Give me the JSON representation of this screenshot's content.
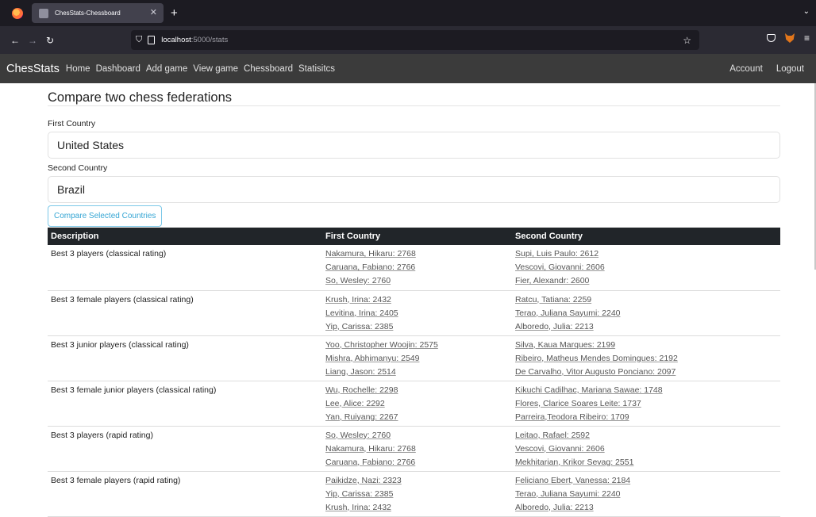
{
  "browser": {
    "tab_title": "ChesStats-Chessboard",
    "url_host": "localhost",
    "url_path": ":5000/stats"
  },
  "nav": {
    "brand": "ChesStats",
    "links": [
      "Home",
      "Dashboard",
      "Add game",
      "View game",
      "Chessboard",
      "Statisitcs"
    ],
    "account": "Account",
    "logout": "Logout"
  },
  "page": {
    "title": "Compare two chess federations",
    "first_label": "First Country",
    "first_value": "United States",
    "second_label": "Second Country",
    "second_value": "Brazil",
    "compare_button": "Compare Selected Countries"
  },
  "table": {
    "headers": [
      "Description",
      "First Country",
      "Second Country"
    ],
    "rows": [
      {
        "desc": "Best 3 players (classical rating)",
        "first": [
          "Nakamura, Hikaru: 2768",
          "Caruana, Fabiano: 2766",
          "So, Wesley: 2760"
        ],
        "second": [
          "Supi, Luis Paulo: 2612",
          "Vescovi, Giovanni: 2606",
          "Fier, Alexandr: 2600"
        ]
      },
      {
        "desc": "Best 3 female players (classical rating)",
        "first": [
          "Krush, Irina: 2432",
          "Levitina, Irina: 2405",
          "Yip, Carissa: 2385"
        ],
        "second": [
          "Ratcu, Tatiana: 2259",
          "Terao, Juliana Sayumi: 2240",
          "Alboredo, Julia: 2213"
        ]
      },
      {
        "desc": "Best 3 junior players (classical rating)",
        "first": [
          "Yoo, Christopher Woojin: 2575",
          "Mishra, Abhimanyu: 2549",
          "Liang, Jason: 2514"
        ],
        "second": [
          "Silva, Kaua Marques: 2199",
          "Ribeiro, Matheus Mendes Domingues: 2192",
          "De Carvalho, Vitor Augusto Ponciano: 2097"
        ]
      },
      {
        "desc": "Best 3 female junior players (classical rating)",
        "first": [
          "Wu, Rochelle: 2298",
          "Lee, Alice: 2292",
          "Yan, Ruiyang: 2267"
        ],
        "second": [
          "Kikuchi Cadilhac, Mariana Sawae: 1748",
          "Flores, Clarice Soares Leite: 1737",
          "Parreira,Teodora Ribeiro: 1709"
        ]
      },
      {
        "desc": "Best 3 players (rapid rating)",
        "first": [
          "So, Wesley: 2760",
          "Nakamura, Hikaru: 2768",
          "Caruana, Fabiano: 2766"
        ],
        "second": [
          "Leitao, Rafael: 2592",
          "Vescovi, Giovanni: 2606",
          "Mekhitarian, Krikor Sevag: 2551"
        ]
      },
      {
        "desc": "Best 3 female players (rapid rating)",
        "first": [
          "Paikidze, Nazi: 2323",
          "Yip, Carissa: 2385",
          "Krush, Irina: 2432"
        ],
        "second": [
          "Feliciano Ebert, Vanessa: 2184",
          "Terao, Juliana Sayumi: 2240",
          "Alboredo, Julia: 2213"
        ]
      }
    ]
  }
}
